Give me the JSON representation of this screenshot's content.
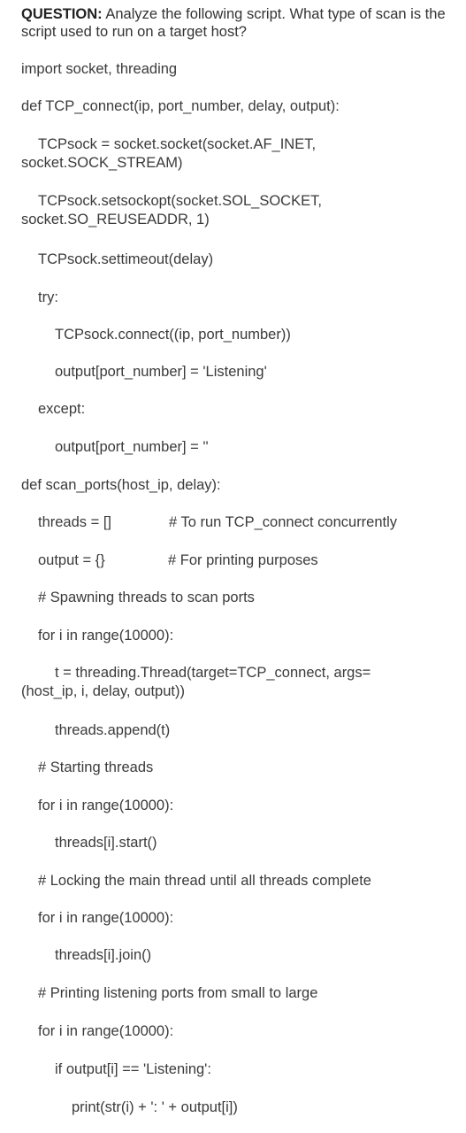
{
  "question": {
    "label": "QUESTION:",
    "text": " Analyze the following script. What type of scan is the script used to run on a target host?"
  },
  "code": {
    "import": "import socket, threading",
    "def_tcp_connect": "def TCP_connect(ip, port_number, delay, output):",
    "tcpsock_create": "TCPsock = socket.socket(socket.AF_INET, socket.SOCK_STREAM)",
    "tcpsock_create_line1": "TCPsock = socket.socket(socket.AF_INET,",
    "tcpsock_create_line2": "socket.SOCK_STREAM)",
    "setsockopt_line1": "TCPsock.setsockopt(socket.SOL_SOCKET,",
    "setsockopt_line2": "socket.SO_REUSEADDR, 1)",
    "settimeout": "TCPsock.settimeout(delay)",
    "try": "try:",
    "connect": "TCPsock.connect((ip, port_number))",
    "output_listening": "output[port_number] = 'Listening'",
    "except": "except:",
    "output_empty": "output[port_number] = ''",
    "def_scan_ports": "def scan_ports(host_ip, delay):",
    "threads_init": "threads = []",
    "threads_comment": "# To run TCP_connect concurrently",
    "output_init": "output = {}",
    "output_comment": "# For printing purposes",
    "spawn_comment": "# Spawning threads to scan ports",
    "for_spawn": "for i in range(10000):",
    "thread_create_line1": "t = threading.Thread(target=TCP_connect, args=",
    "thread_create_line2": "(host_ip, i, delay, output))",
    "append": "threads.append(t)",
    "start_comment": "# Starting threads",
    "for_start": "for i in range(10000):",
    "start": "threads[i].start()",
    "lock_comment": "# Locking the main thread until all threads complete",
    "for_join": "for i in range(10000):",
    "join": "threads[i].join()",
    "print_comment": "# Printing listening ports from small to large",
    "for_print": "for i in range(10000):",
    "if_listening": "if output[i] == 'Listening':",
    "print": "print(str(i) + ': ' + output[i])"
  }
}
